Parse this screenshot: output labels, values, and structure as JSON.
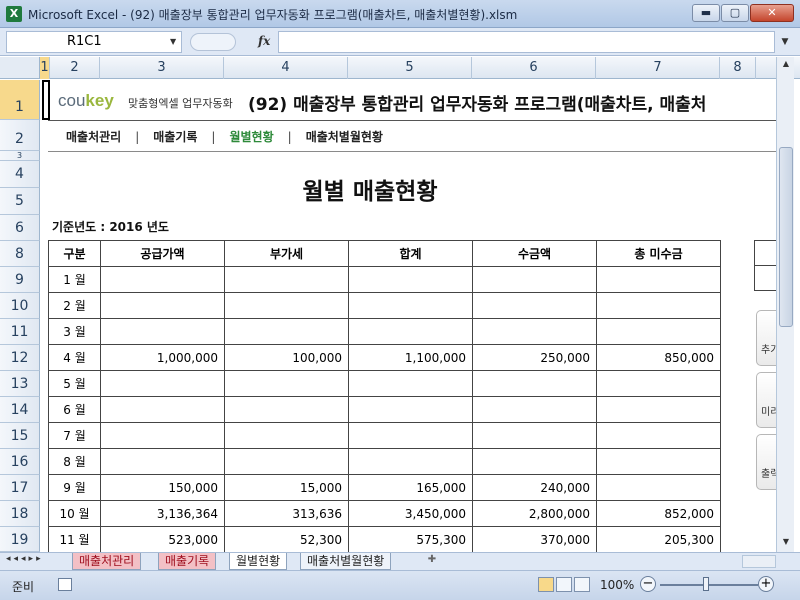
{
  "window": {
    "title": "Microsoft Excel - (92) 매출장부 통합관리 업무자동화 프로그램(매출차트, 매출처별현황).xlsm",
    "icon_letter": "X",
    "min_label": "▬",
    "max_label": "▢",
    "close_label": "✕"
  },
  "formula_bar": {
    "name_box": "R1C1",
    "fx_label": "fx",
    "formula": ""
  },
  "columns": [
    "1",
    "2",
    "3",
    "4",
    "5",
    "6",
    "7",
    "8"
  ],
  "rows": [
    "1",
    "2",
    "3",
    "4",
    "5",
    "6",
    "8",
    "9",
    "10",
    "11",
    "12",
    "13",
    "14",
    "15",
    "16",
    "17",
    "18",
    "19"
  ],
  "header": {
    "logo_main": "cou",
    "logo_accent": "key",
    "logo_sub": "맞춤형엑셀 업무자동화",
    "title": "(92) 매출장부 통합관리 업무자동화 프로그램(매출차트, 매출처"
  },
  "nav": {
    "items": [
      {
        "label": "매출처관리"
      },
      {
        "label": "매출기록"
      },
      {
        "label": "월별현황"
      },
      {
        "label": "매출처별월현황"
      }
    ],
    "separator": "|"
  },
  "report": {
    "title": "월별 매출현황",
    "year_label": "기준년도 : 2016 년도"
  },
  "table": {
    "headers": [
      "구분",
      "공급가액",
      "부가세",
      "합계",
      "수금액",
      "총 미수금"
    ],
    "rows": [
      {
        "month": "1 월",
        "supply": "",
        "vat": "",
        "total": "",
        "collected": "",
        "outstanding": ""
      },
      {
        "month": "2 월",
        "supply": "",
        "vat": "",
        "total": "",
        "collected": "",
        "outstanding": ""
      },
      {
        "month": "3 월",
        "supply": "",
        "vat": "",
        "total": "",
        "collected": "",
        "outstanding": ""
      },
      {
        "month": "4 월",
        "supply": "1,000,000",
        "vat": "100,000",
        "total": "1,100,000",
        "collected": "250,000",
        "outstanding": "850,000"
      },
      {
        "month": "5 월",
        "supply": "",
        "vat": "",
        "total": "",
        "collected": "",
        "outstanding": ""
      },
      {
        "month": "6 월",
        "supply": "",
        "vat": "",
        "total": "",
        "collected": "",
        "outstanding": ""
      },
      {
        "month": "7 월",
        "supply": "",
        "vat": "",
        "total": "",
        "collected": "",
        "outstanding": ""
      },
      {
        "month": "8 월",
        "supply": "",
        "vat": "",
        "total": "",
        "collected": "",
        "outstanding": ""
      },
      {
        "month": "9 월",
        "supply": "150,000",
        "vat": "15,000",
        "total": "165,000",
        "collected": "240,000",
        "outstanding": ""
      },
      {
        "month": "10 월",
        "supply": "3,136,364",
        "vat": "313,636",
        "total": "3,450,000",
        "collected": "2,800,000",
        "outstanding": "852,000"
      },
      {
        "month": "11 월",
        "supply": "523,000",
        "vat": "52,300",
        "total": "575,300",
        "collected": "370,000",
        "outstanding": "205,300"
      }
    ]
  },
  "side_buttons": [
    {
      "label": "추가"
    },
    {
      "label": "미리"
    },
    {
      "label": "출력"
    }
  ],
  "sheet_tabs": [
    {
      "label": "매출처관리"
    },
    {
      "label": "매출기록"
    },
    {
      "label": "월별현황"
    },
    {
      "label": "매출처별월현황"
    }
  ],
  "tab_nav": "◂◂◂▸▸",
  "status": {
    "ready": "준비",
    "zoom": "100%",
    "zoom_minus": "−",
    "zoom_plus": "+"
  }
}
